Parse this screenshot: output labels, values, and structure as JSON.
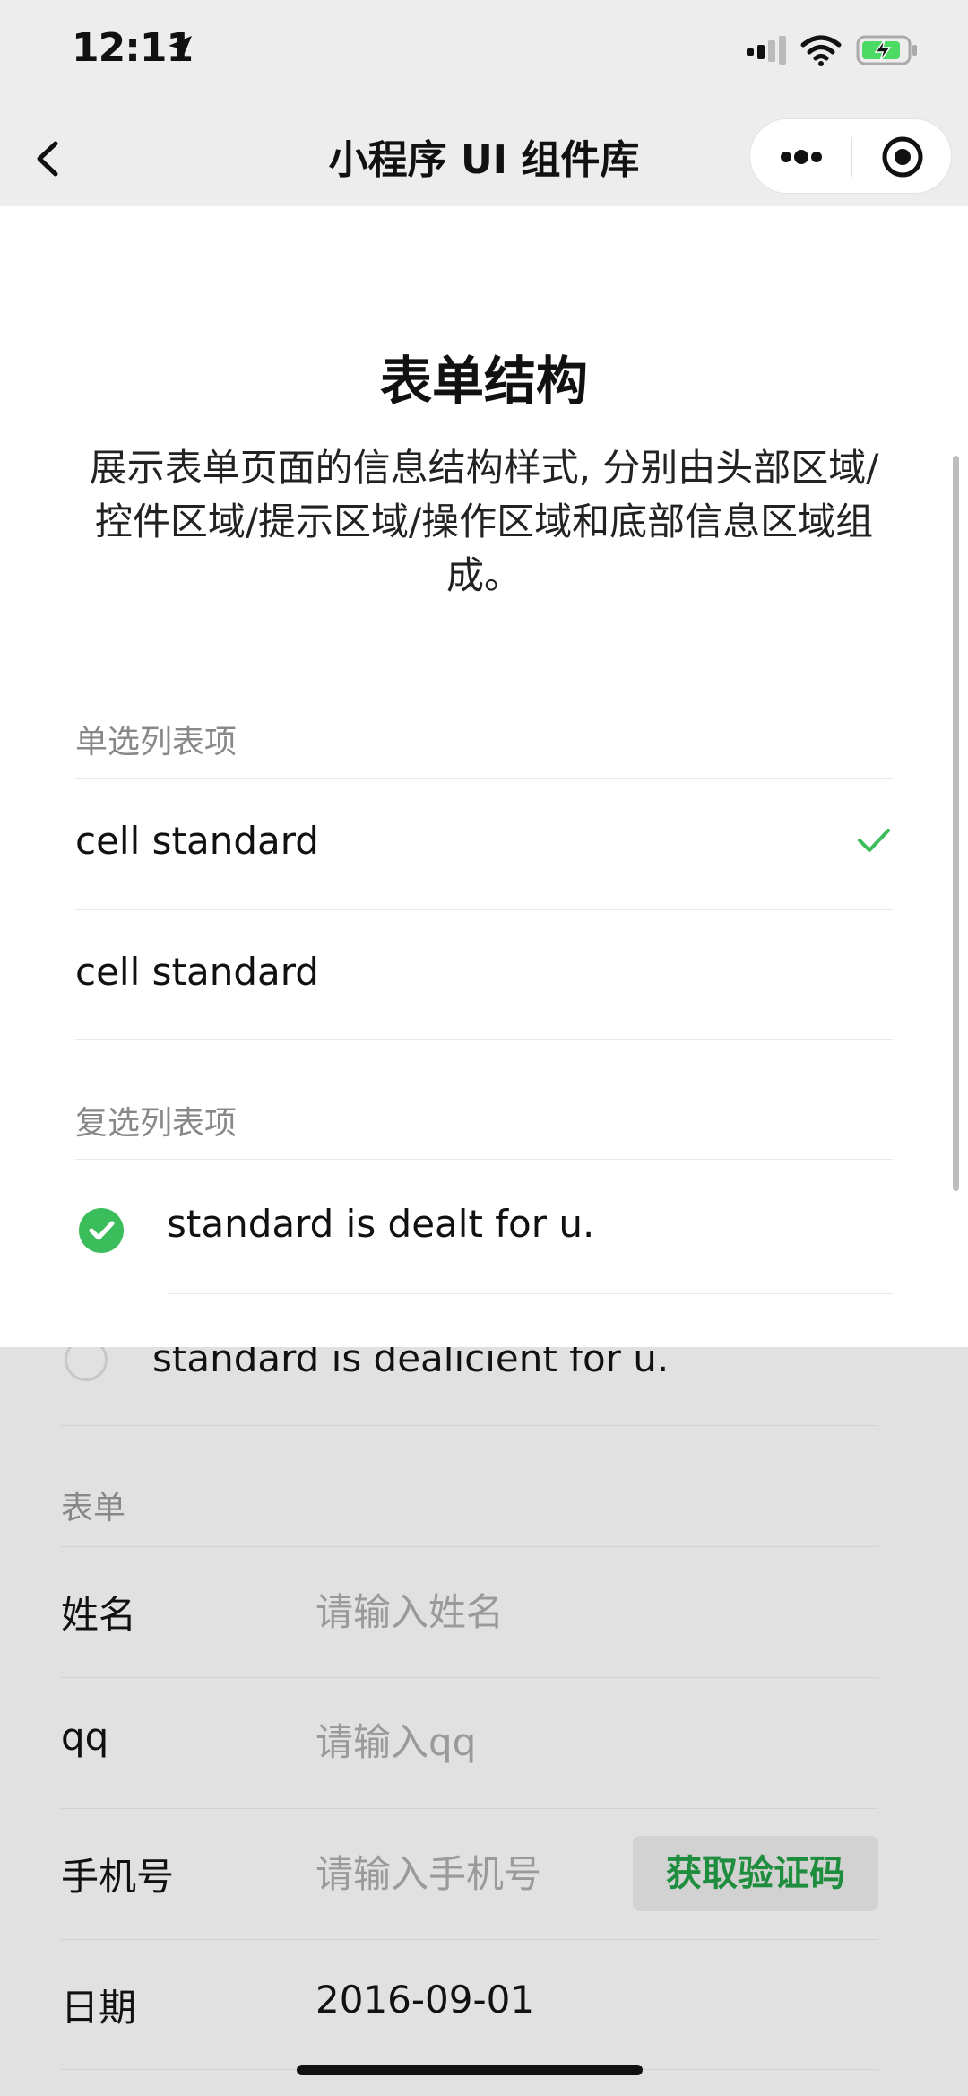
{
  "status_bar": {
    "time": "12:11"
  },
  "nav": {
    "title": "小程序 UI 组件库"
  },
  "page": {
    "title": "表单结构",
    "description": "展示表单页面的信息结构样式, 分别由头部区域/控件区域/提示区域/操作区域和底部信息区域组成。"
  },
  "radio_section": {
    "label": "单选列表项",
    "items": [
      {
        "label": "cell standard",
        "checked": true
      },
      {
        "label": "cell standard",
        "checked": false
      }
    ]
  },
  "checkbox_section": {
    "label": "复选列表项",
    "items": [
      {
        "label": "standard is dealt for u.",
        "checked": true
      },
      {
        "label": "standard is dealicient for u.",
        "checked": false
      }
    ]
  },
  "form_section": {
    "label": "表单",
    "name": {
      "label": "姓名",
      "placeholder": "请输入姓名"
    },
    "qq": {
      "label": "qq",
      "placeholder": "请输入qq"
    },
    "phone": {
      "label": "手机号",
      "placeholder": "请输入手机号",
      "code_button": "获取验证码"
    },
    "date": {
      "label": "日期",
      "value": "2016-09-01"
    }
  },
  "colors": {
    "accent_green": "#3cbd5b",
    "code_button_text": "#1e8e3e"
  }
}
